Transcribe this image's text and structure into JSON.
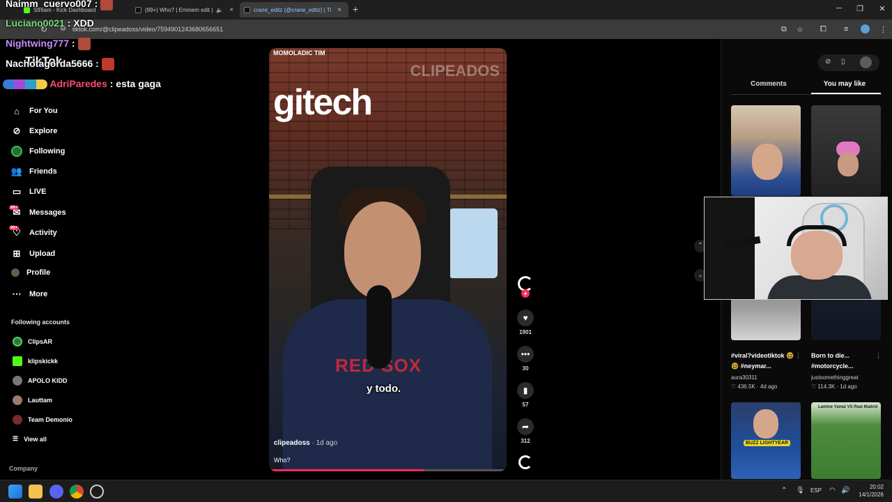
{
  "browser": {
    "tabs": [
      {
        "label": "Stream - Kick Dashboard",
        "favicon": "kick-icon"
      },
      {
        "label": "(99+) Who? | Eminem edit |",
        "favicon": "tiktok-icon"
      },
      {
        "label": "crane_editz (@crane_editz) | Ti",
        "favicon": "tiktok-icon"
      }
    ],
    "new_tab_label": "+",
    "url": "tiktok.com/@clipeadoss/video/7594901243680656651"
  },
  "chat": [
    {
      "user": "Naimm_cuervo007",
      "sep": " :",
      "text": "",
      "color": "#ffffff"
    },
    {
      "user": "Luciano0021",
      "sep": " :",
      "text": " XDD",
      "color": "#7ee07e"
    },
    {
      "user": "Nightwing777",
      "sep": " :",
      "text": "",
      "color": "#c78bff"
    },
    {
      "user": "Nachotagorda5666",
      "sep": " :",
      "text": "",
      "color": "#ffffff"
    },
    {
      "user": "AdriParedes",
      "sep": " :",
      "text": " esta gaga",
      "color": "#ff4d6d"
    }
  ],
  "sidebar": {
    "brand": "TikTok",
    "items": [
      {
        "label": "For You",
        "icon": "home-icon"
      },
      {
        "label": "Explore",
        "icon": "compass-icon"
      },
      {
        "label": "Following",
        "icon": "following-icon"
      },
      {
        "label": "Friends",
        "icon": "friends-icon"
      },
      {
        "label": "LIVE",
        "icon": "live-icon"
      },
      {
        "label": "Messages",
        "icon": "messages-icon",
        "badge": "99+"
      },
      {
        "label": "Activity",
        "icon": "activity-icon",
        "badge": "99+"
      },
      {
        "label": "Upload",
        "icon": "upload-icon"
      },
      {
        "label": "Profile",
        "icon": "profile-icon"
      },
      {
        "label": "More",
        "icon": "more-icon"
      }
    ],
    "following_header": "Following accounts",
    "accounts": [
      "ClipsAR",
      "klipskickk",
      "APOLO KIDD",
      "Lauttam",
      "Team Demonio"
    ],
    "view_all": "View all",
    "company": "Company"
  },
  "video": {
    "sign_text": "MOMOLADIC TIM",
    "logo_text": "gitech",
    "watermark": "CLIPEADOS",
    "shirt_text": "RED SOX",
    "subtitle": "y todo.",
    "author": "clipeadoss",
    "date": " · 1d ago",
    "caption": "Who?",
    "progress": 0.65,
    "likes": "1901",
    "comments": "30",
    "saves": "57",
    "shares": "312"
  },
  "right_panel": {
    "tab_comments": "Comments",
    "tab_like": "You may like",
    "cards": [
      {
        "title": "#viral?videotiktok 🤓🤓 #neymar...",
        "user": "aura30311",
        "likes": "436.5K",
        "age": "4d ago"
      },
      {
        "title": "Born to die... #motorcycle...",
        "user": "justsomethinggreat",
        "likes": "114.3K",
        "age": "1d ago"
      }
    ],
    "thumb_tag_right": "Lamine Yamal VS Real Madrid",
    "thumb_tag_left": "BUZZ LIGHTYEAR"
  },
  "taskbar": {
    "lang": "ESP",
    "time": "20:02",
    "date": "14/1/2026"
  },
  "colors": {
    "accent": "#fe2c55",
    "background": "#000000"
  }
}
